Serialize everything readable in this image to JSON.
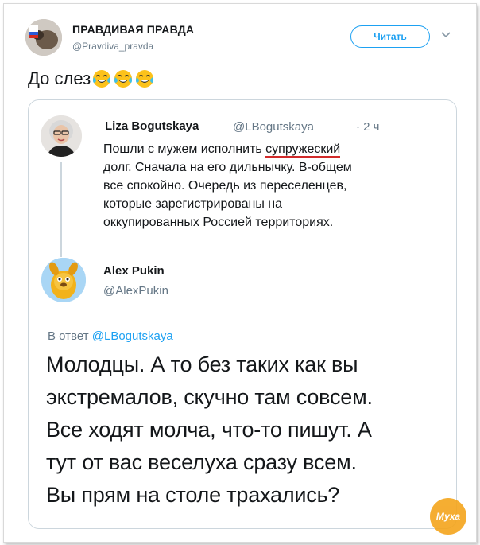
{
  "header": {
    "account_name": "ПРАВДИВАЯ ПРАВДА",
    "account_handle": "@Pravdiva_pravda",
    "follow_label": "Читать"
  },
  "tweet": {
    "text": "До слез",
    "emoji": [
      "face-with-tears-of-joy",
      "face-with-tears-of-joy",
      "face-with-tears-of-joy"
    ]
  },
  "quoted": {
    "name": "Liza Bogutskaya",
    "handle": "@LBogutskaya",
    "time": "· 2 ч",
    "lines": [
      "Пошли с мужем исполнить ",
      "долг. Сначала на его дильнычку. В-общем",
      "все спокойно. Очередь из переселенцев,",
      "которые зарегистрированы на",
      "оккупированных Россией территориях."
    ],
    "underlined_word": "супружеский"
  },
  "reply": {
    "name": "Alex Pukin",
    "handle": "@AlexPukin",
    "reply_prefix": "В ответ ",
    "reply_link": "@LBogutskaya",
    "lines": [
      "Молодцы. А то без таких как вы",
      "экстремалов, скучно там совсем.",
      "Все ходят молча, что-то пишут. А",
      "тут от вас веселуха сразу всем.",
      "Вы прям на столе трахались?"
    ]
  },
  "watermark": {
    "text": "Муха"
  },
  "colors": {
    "accent": "#1da1f2",
    "muted": "#657786",
    "underline": "#d12a2a",
    "watermark": "#f4a51c"
  }
}
